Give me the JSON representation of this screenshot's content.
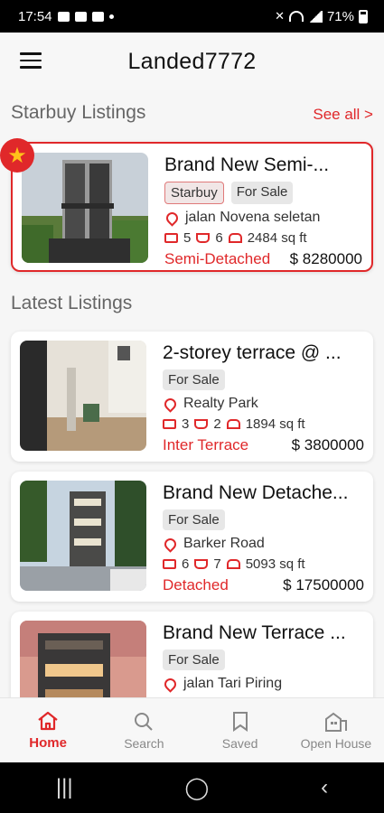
{
  "status": {
    "time": "17:54",
    "battery": "71%"
  },
  "header": {
    "title": "Landed7772"
  },
  "starbuy": {
    "section_title": "Starbuy Listings",
    "see_all": "See all >",
    "listing": {
      "title": "Brand New Semi-...",
      "tags": [
        "Starbuy",
        "For Sale"
      ],
      "location": "jalan Novena seletan",
      "beds": "5",
      "baths": "6",
      "area": "2484 sq ft",
      "property_type": "Semi-Detached",
      "price": "$ 8280000"
    }
  },
  "latest": {
    "section_title": "Latest Listings",
    "listings": [
      {
        "title": "2-storey terrace @ ...",
        "tag": "For Sale",
        "location": "Realty Park",
        "beds": "3",
        "baths": "2",
        "area": "1894 sq ft",
        "property_type": "Inter Terrace",
        "price": "$ 3800000"
      },
      {
        "title": "Brand New Detache...",
        "tag": "For Sale",
        "location": "Barker Road",
        "beds": "6",
        "baths": "7",
        "area": "5093 sq ft",
        "property_type": "Detached",
        "price": "$ 17500000"
      },
      {
        "title": "Brand New Terrace ...",
        "tag": "For Sale",
        "location": "jalan Tari Piring"
      }
    ]
  },
  "bottom_nav": {
    "items": [
      {
        "label": "Home",
        "icon": "home-icon"
      },
      {
        "label": "Search",
        "icon": "search-icon"
      },
      {
        "label": "Saved",
        "icon": "bookmark-icon"
      },
      {
        "label": "Open House",
        "icon": "open-house-icon"
      }
    ]
  },
  "colors": {
    "accent": "#e0282a",
    "star": "#ffc21a"
  }
}
